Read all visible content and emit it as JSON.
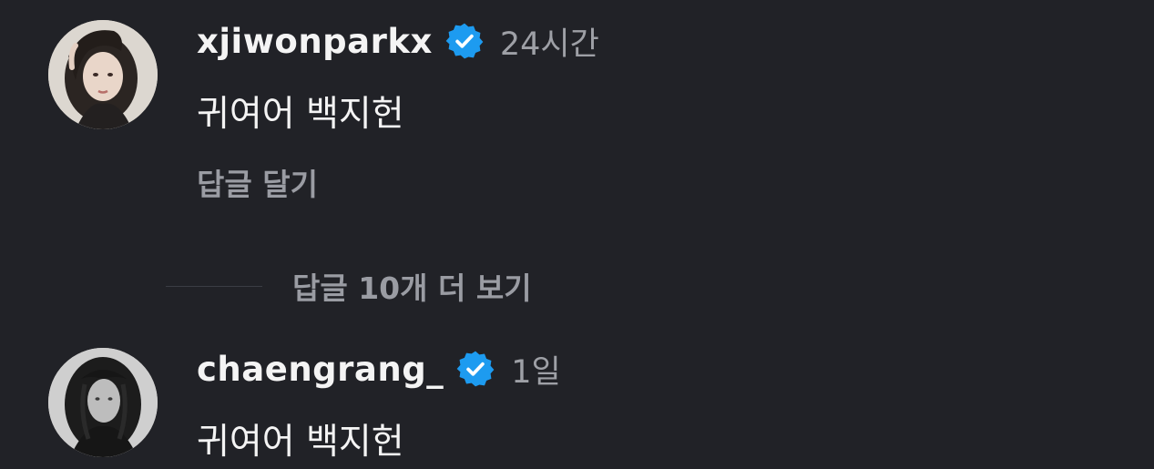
{
  "comments": [
    {
      "username": "xjiwonparkx",
      "verified": true,
      "time": "24시간",
      "text": "귀여어 백지헌",
      "reply_label": "답글 달기",
      "avatar_icon": "profile-photo-avatar"
    },
    {
      "username": "chaengrang_",
      "verified": true,
      "time": "1일",
      "text": "귀여어 백지헌",
      "avatar_icon": "profile-photo-avatar"
    }
  ],
  "view_replies_label": "답글 10개 더 보기",
  "colors": {
    "background": "#212227",
    "verified_badge": "#1d9bf0",
    "primary_text": "#f4f4f4",
    "secondary_text": "#9a9ca3"
  }
}
